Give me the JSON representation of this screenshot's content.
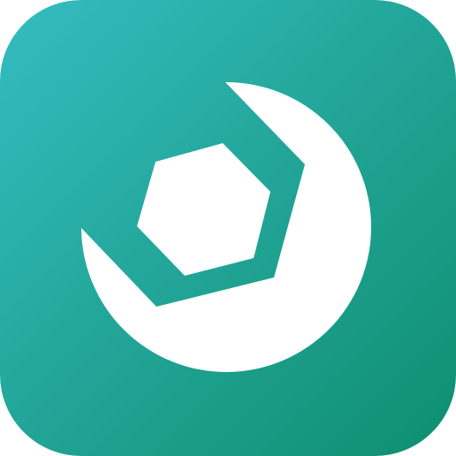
{
  "app_icon": {
    "icon_name": "wrench-nut-icon",
    "gradient_start": "#35BCC0",
    "gradient_end": "#0E8E6F",
    "glyph_color": "#FFFFFF"
  }
}
